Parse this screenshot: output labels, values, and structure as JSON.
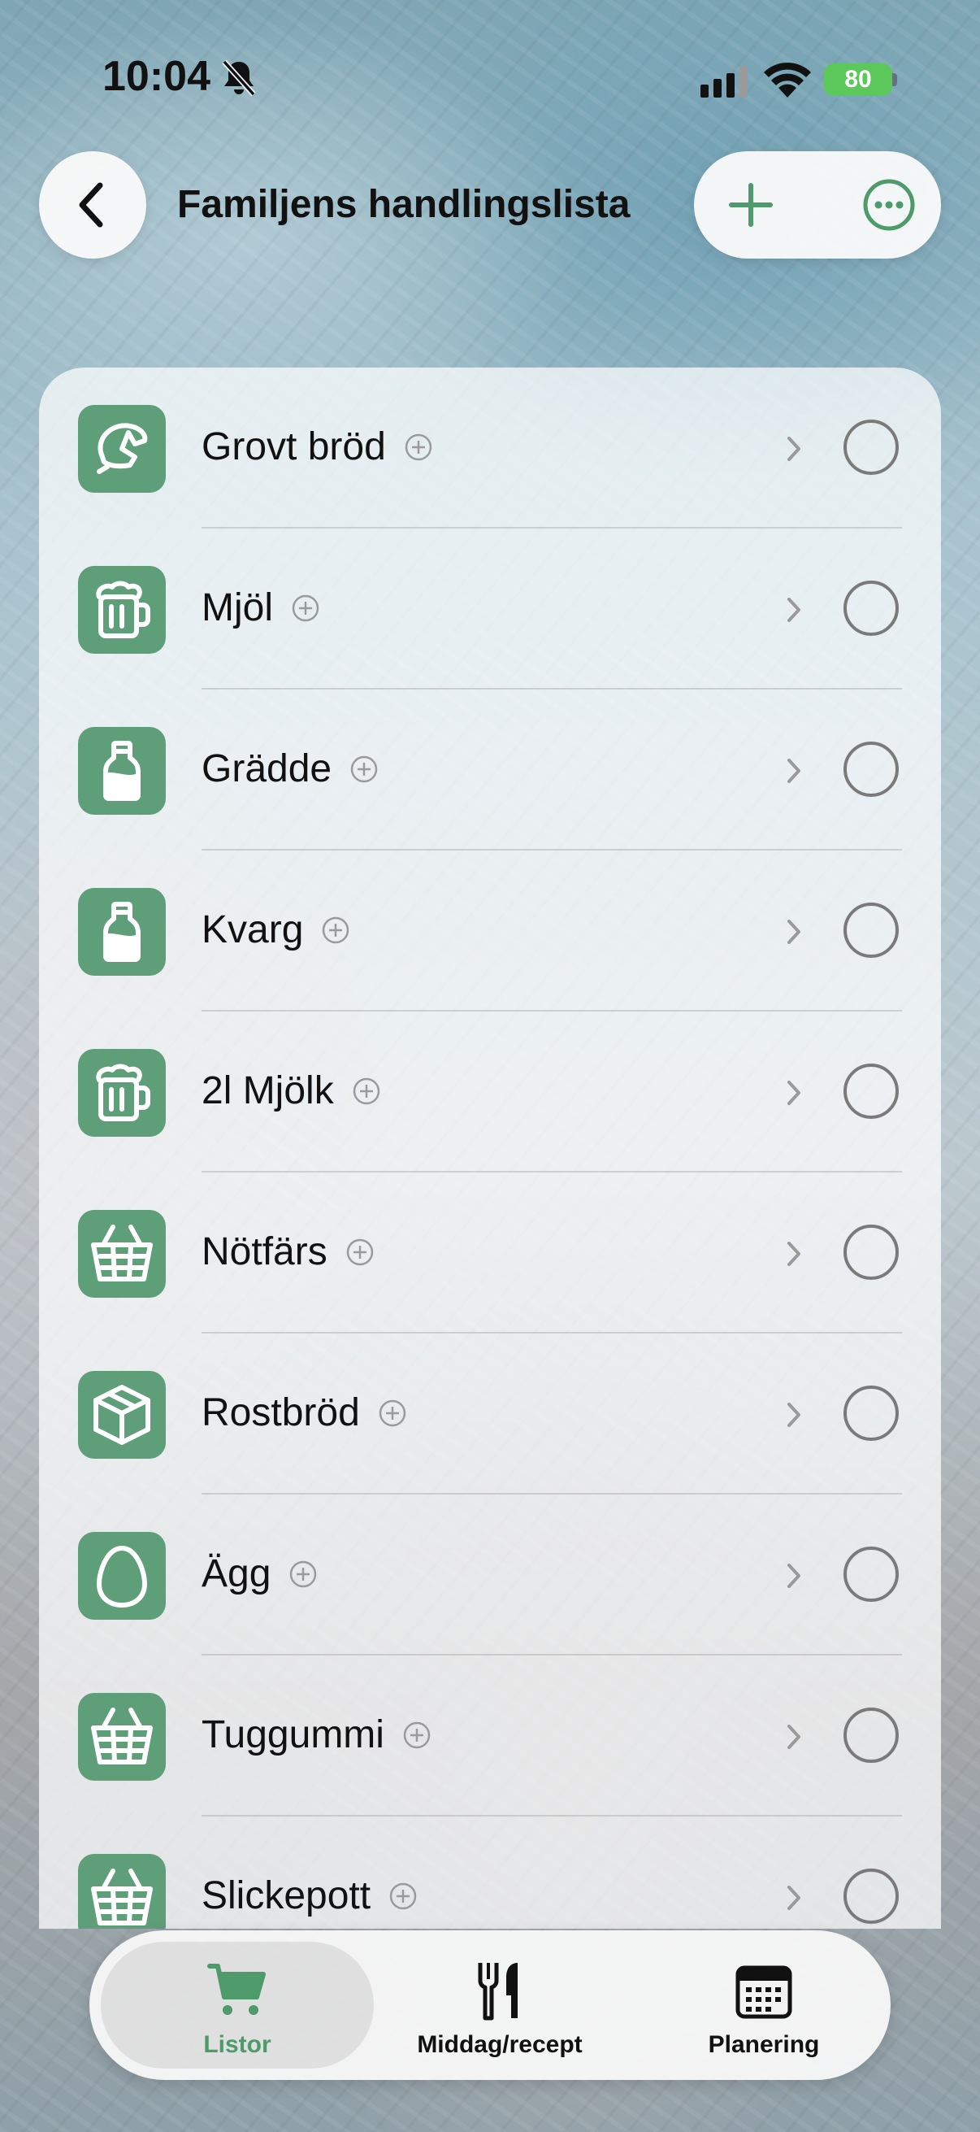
{
  "status_bar": {
    "time": "10:04",
    "battery": "80",
    "bell_icon": "bell-slash-icon",
    "signal_icon": "cellular-signal-icon",
    "wifi_icon": "wifi-icon"
  },
  "header": {
    "title": "Familjens handlingslista",
    "back_icon": "chevron-left-icon",
    "add_icon": "plus-icon",
    "more_icon": "ellipsis-circle-icon"
  },
  "colors": {
    "accent": "#5e9f7a",
    "tab_active_label": "#4e9a6b",
    "battery": "#5cc75a"
  },
  "items": [
    {
      "label": "Grovt bröd",
      "icon": "croissant-icon",
      "checked": false
    },
    {
      "label": "Mjöl",
      "icon": "beer-mug-icon",
      "checked": false
    },
    {
      "label": "Grädde",
      "icon": "milk-bottle-icon",
      "checked": false
    },
    {
      "label": "Kvarg",
      "icon": "milk-bottle-icon",
      "checked": false
    },
    {
      "label": "2l Mjölk",
      "icon": "beer-mug-icon",
      "checked": false
    },
    {
      "label": "Nötfärs",
      "icon": "basket-icon",
      "checked": false
    },
    {
      "label": "Rostbröd",
      "icon": "box-icon",
      "checked": false
    },
    {
      "label": "Ägg",
      "icon": "egg-icon",
      "checked": false
    },
    {
      "label": "Tuggummi",
      "icon": "basket-icon",
      "checked": false
    },
    {
      "label": "Slickepott",
      "icon": "basket-icon",
      "checked": false
    }
  ],
  "tabs": [
    {
      "label": "Listor",
      "icon": "cart-icon",
      "active": true
    },
    {
      "label": "Middag/recept",
      "icon": "fork-knife-icon",
      "active": false
    },
    {
      "label": "Planering",
      "icon": "calendar-icon",
      "active": false
    }
  ]
}
